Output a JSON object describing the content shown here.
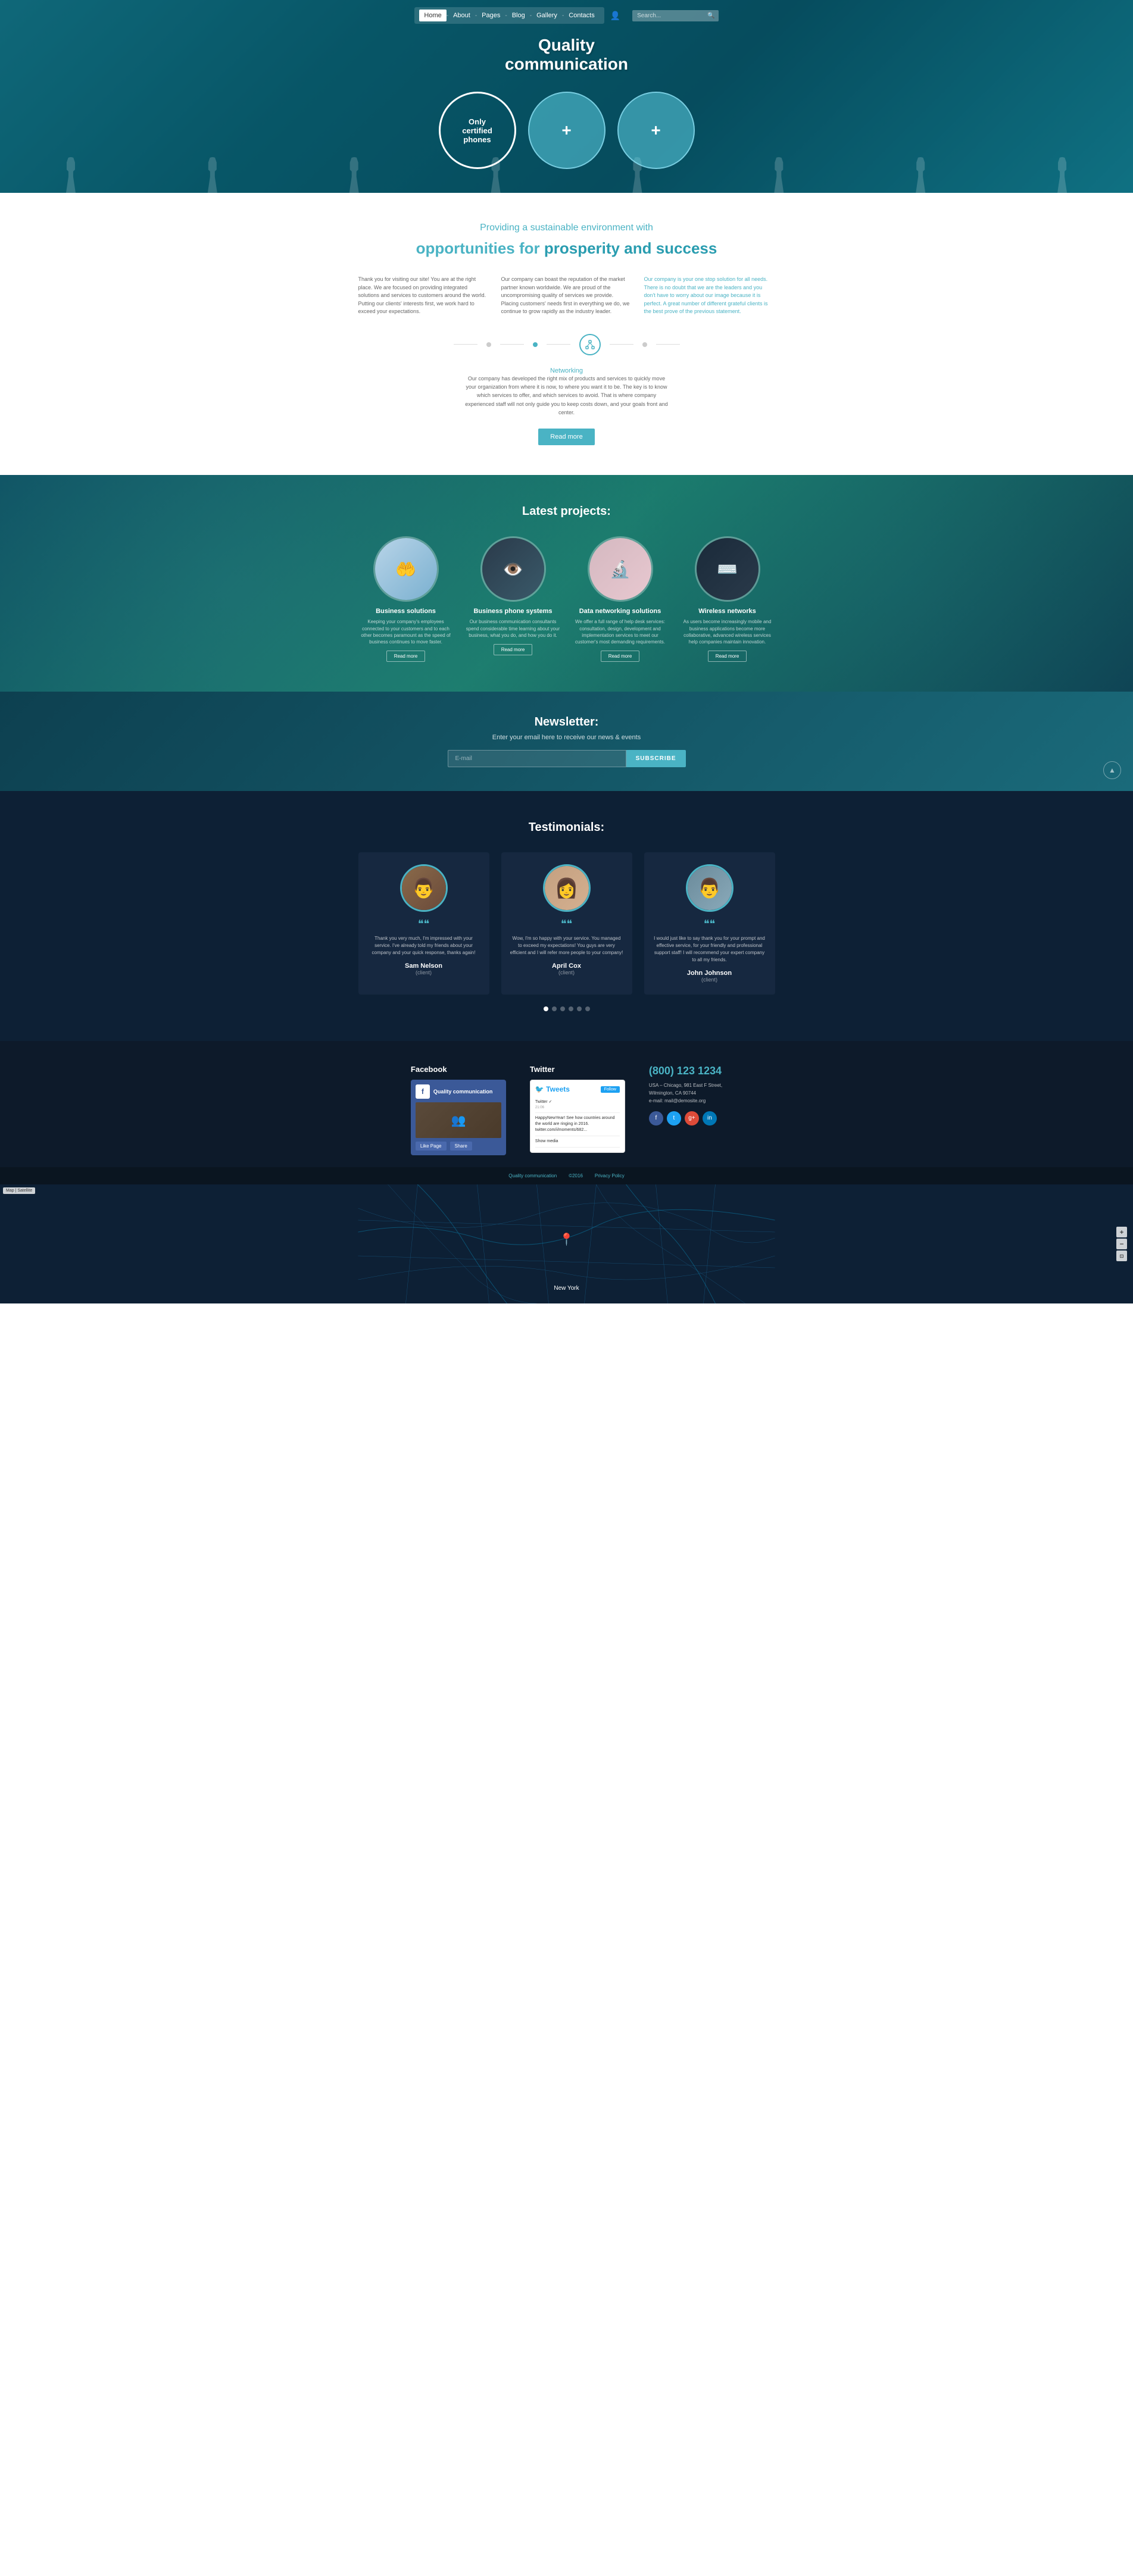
{
  "nav": {
    "links": [
      {
        "label": "Home",
        "active": true
      },
      {
        "label": "About",
        "active": false
      },
      {
        "label": "Pages",
        "active": false
      },
      {
        "label": "Blog",
        "active": false
      },
      {
        "label": "Gallery",
        "active": false
      },
      {
        "label": "Contacts",
        "active": false
      }
    ],
    "search_placeholder": "Search..."
  },
  "hero": {
    "title": "Quality\ncommunication",
    "circle1": {
      "line1": "Only",
      "line2": "certified",
      "line3": "phones"
    },
    "circle2_icon": "+",
    "circle3_icon": "+"
  },
  "prosperity": {
    "subtitle": "Providing a sustainable environment with",
    "title_part1": "opportunities for",
    "title_bold": "prosperity and success",
    "col1_text": "Thank you for visiting our site! You are at the right place. We are focused on providing integrated solutions and services to customers around the world. Putting our clients' interests first, we work hard to exceed your expectations.",
    "col2_text": "Our company can boast the reputation of the market partner known worldwide. We are proud of the uncompromising quality of services we provide. Placing customers' needs first in everything we do, we continue to grow rapidly as the industry leader.",
    "col3_text": "Our company is your one stop solution for all needs. There is no doubt that we are the leaders and you don't have to worry about our image because it is perfect. A great number of different grateful clients is the best prove of the previous statement.",
    "tab_label": "Networking",
    "networking_text": "Our company has developed the right mix of products and services to quickly move your organization from where it is now, to where you want it to be. The key is to know which services to offer, and which services to avoid. That is where company experienced staff will not only guide you to keep costs down, and your goals front and center.",
    "read_more": "Read more"
  },
  "projects": {
    "title": "Latest projects:",
    "items": [
      {
        "title": "Business solutions",
        "desc": "Keeping your company's employees connected to your customers and to each other becomes paramount as the speed of business continues to move faster.",
        "btn": "Read more",
        "emoji": "🤲"
      },
      {
        "title": "Business phone systems",
        "desc": "Our business communication consultants spend considerable time learning about your business, what you do, and how you do it.",
        "btn": "Read more",
        "emoji": "👁"
      },
      {
        "title": "Data networking solutions",
        "desc": "We offer a full range of help desk services: consultation, design, development and implementation services to meet our customer's most demanding requirements.",
        "btn": "Read more",
        "emoji": "🧪"
      },
      {
        "title": "Wireless networks",
        "desc": "As users become increasingly mobile and business applications become more collaborative, advanced wireless services help companies maintain innovation.",
        "btn": "Read more",
        "emoji": "⌨️"
      }
    ]
  },
  "newsletter": {
    "title": "Newsletter:",
    "subtitle": "Enter your email here to receive our news & events",
    "placeholder": "E-mail",
    "btn_label": "SUBSCRIBE"
  },
  "testimonials": {
    "title": "Testimonials:",
    "items": [
      {
        "text": "Thank you very much, I'm impressed with your service. I've already told my friends about your company and your quick response, thanks again!",
        "name": "Sam Nelson",
        "role": "(client)"
      },
      {
        "text": "Wow, I'm so happy with your service. You managed to exceed my expectations! You guys are very efficient and I will refer more people to your company!",
        "name": "April Cox",
        "role": "(client)"
      },
      {
        "text": "I would just like to say thank you for your prompt and effective service, for your friendly and professional support staff! I will recommend your expert company to all my friends.",
        "name": "John Johnson",
        "role": "(client)"
      }
    ],
    "dots": 6,
    "active_dot": 0
  },
  "footer": {
    "facebook_title": "Facebook",
    "twitter_title": "Twitter",
    "fb_page_name": "Quality communication",
    "fb_likes": "Like Page",
    "fb_share": "Share",
    "tweets": [
      {
        "text": "Twitter ✓",
        "time": "21:06"
      },
      {
        "text": "HappyNewYear! See how countries around the world are ringing in 2016. twitter.com/i/moments/682...",
        "time": ""
      },
      {
        "text": "Show media",
        "time": ""
      }
    ],
    "follow_btn": "Follow",
    "phone": "(800) 123 1234",
    "address_line1": "USA – Chicago, 981 East F Street,",
    "address_line2": "Wilmington, CA 90744",
    "address_line3": "e-mail: mail@demosite.org",
    "social_icons": [
      "f",
      "t",
      "g+",
      "in"
    ],
    "bottom_links": [
      "Quality communication",
      "©2016",
      "Privacy Policy"
    ]
  },
  "map": {
    "label": "New York",
    "google_label": "Map | Satellite"
  }
}
